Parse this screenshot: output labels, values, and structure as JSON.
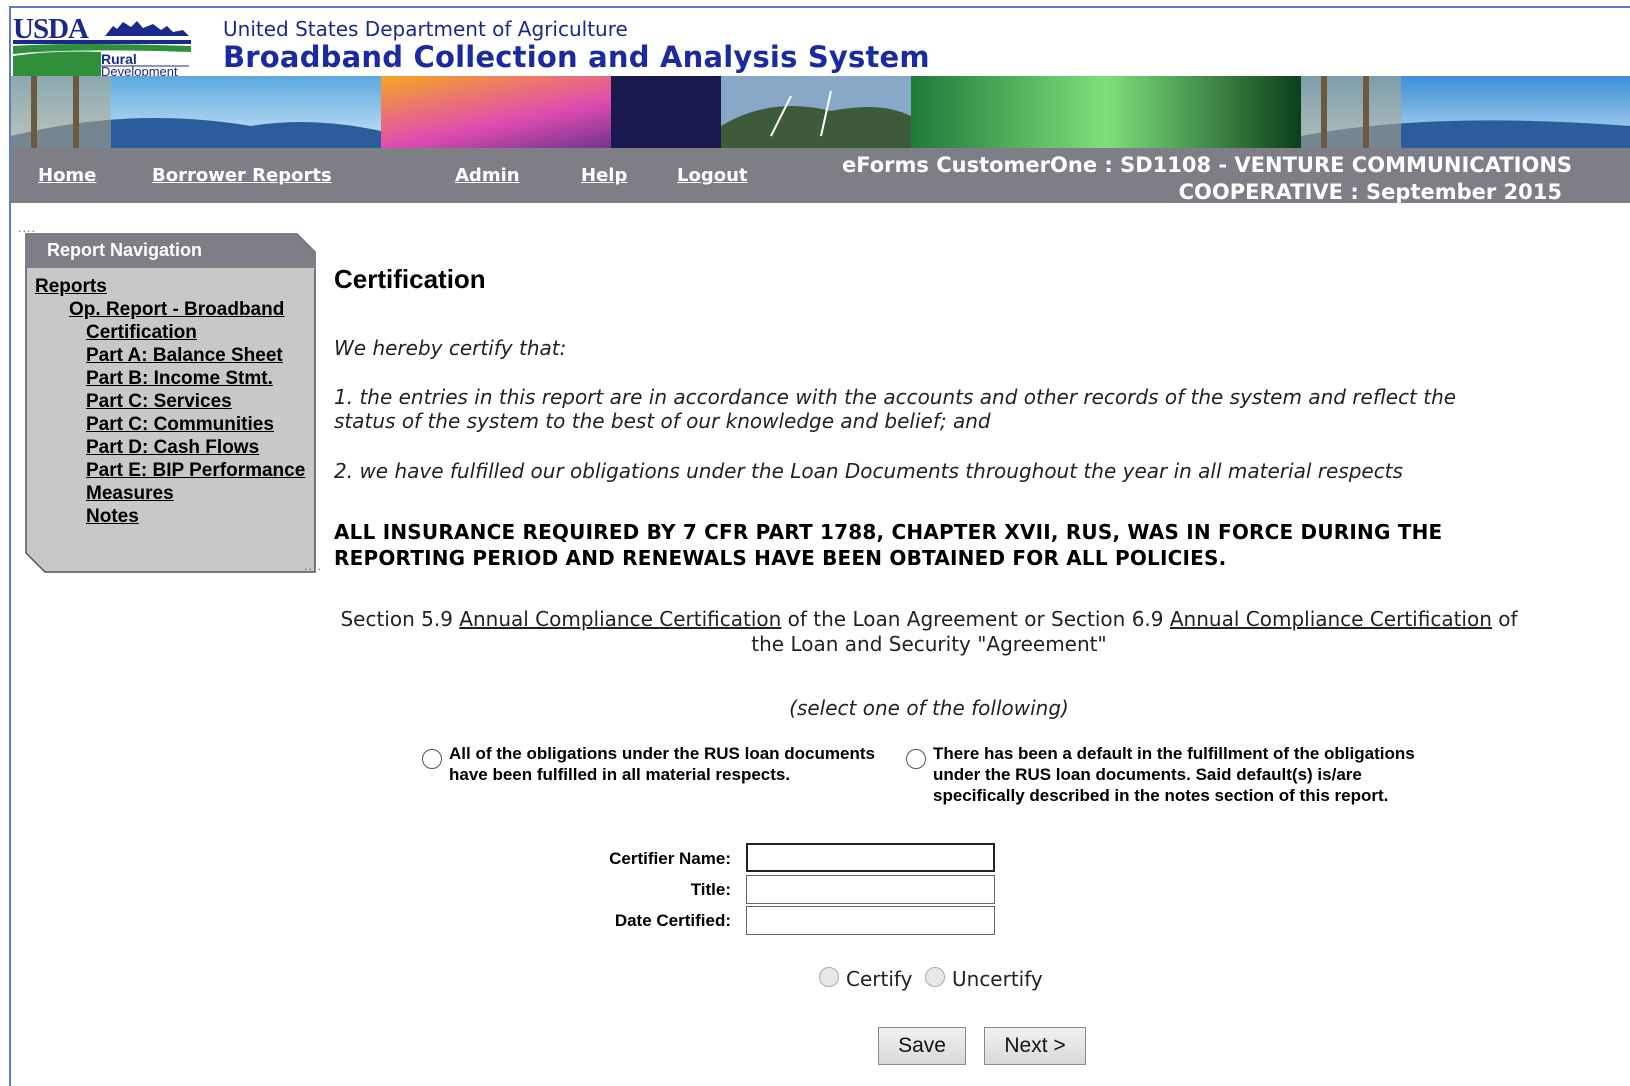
{
  "header": {
    "logo": {
      "mark": "USDA",
      "line1": "Rural",
      "line2": "Development"
    },
    "agency": "United States Department of Agriculture",
    "system": "Broadband Collection and Analysis System"
  },
  "nav": {
    "home": "Home",
    "borrower_reports": "Borrower Reports",
    "admin": "Admin",
    "help": "Help",
    "logout": "Logout",
    "context_line1": "eForms CustomerOne : SD1108 - VENTURE COMMUNICATIONS",
    "context_line2": "COOPERATIVE : September 2015"
  },
  "sidebar": {
    "title": "Report Navigation",
    "items": [
      "Reports",
      "Op. Report - Broadband",
      "Certification",
      "Part A: Balance Sheet",
      "Part B: Income Stmt.",
      "Part C: Services",
      "Part C: Communities",
      "Part D: Cash Flows",
      "Part E: BIP Performance",
      "Measures",
      "Notes"
    ]
  },
  "main": {
    "title": "Certification",
    "intro": "We hereby certify that:",
    "item1": "1. the entries in this report are in accordance with the accounts and other records of the system and reflect the status of the system to the best of our knowledge and belief; and",
    "item2": "2. we have fulfilled our obligations under the Loan Documents throughout the year in all material respects",
    "insurance": "ALL INSURANCE REQUIRED BY 7 CFR PART 1788, CHAPTER XVII, RUS, WAS IN FORCE DURING THE REPORTING PERIOD AND RENEWALS HAVE BEEN OBTAINED FOR ALL POLICIES.",
    "section_prefix": "Section 5.9 ",
    "section_link1": "Annual Compliance Certification",
    "section_mid": " of the Loan Agreement or Section 6.9 ",
    "section_link2": "Annual Compliance Certification",
    "section_suffix": " of the Loan and Security \"Agreement\"",
    "select_note": "(select one of the following)",
    "option1": "All of the obligations under the RUS loan documents have been fulfilled in all material respects.",
    "option2": "There has been a default in the fulfillment of the obligations under the RUS loan documents. Said default(s) is/are specifically described in the notes section of this report.",
    "fields": {
      "name_label": "Certifier Name:",
      "title_label": "Title:",
      "date_label": "Date Certified:",
      "name_value": "",
      "title_value": "",
      "date_value": ""
    },
    "certify_label": "Certify",
    "uncertify_label": "Uncertify",
    "save_label": "Save",
    "next_label": "Next >"
  }
}
